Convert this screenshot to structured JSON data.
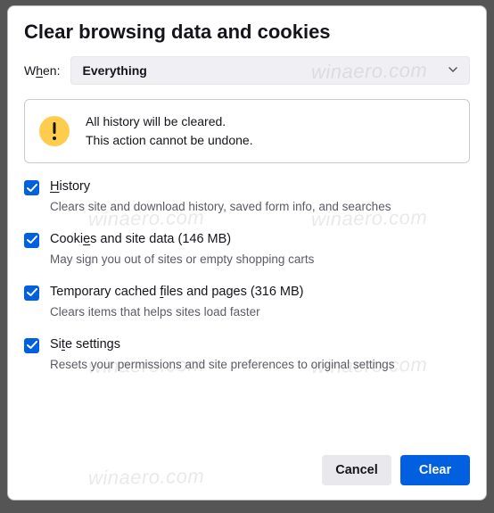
{
  "dialog": {
    "title": "Clear browsing data and cookies",
    "when_label_pre": "W",
    "when_label_mid": "h",
    "when_label_post": "en:",
    "dropdown_value": "Everything",
    "alert_line1": "All history will be cleared.",
    "alert_line2": "This action cannot be undone."
  },
  "options": [
    {
      "label_pre": "",
      "label_u": "H",
      "label_post": "istory",
      "desc": "Clears site and download history, saved form info, and searches"
    },
    {
      "label_pre": "Cooki",
      "label_u": "e",
      "label_post": "s and site data (146 MB)",
      "desc": "May sign you out of sites or empty shopping carts"
    },
    {
      "label_pre": "Temporary cached ",
      "label_u": "f",
      "label_post": "iles and pages (316 MB)",
      "desc": "Clears items that helps sites load faster"
    },
    {
      "label_pre": "Si",
      "label_u": "t",
      "label_post": "e settings",
      "desc": "Resets your permissions and site preferences to original settings"
    }
  ],
  "buttons": {
    "cancel": "Cancel",
    "clear": "Clear"
  },
  "watermark": "winaero.com"
}
